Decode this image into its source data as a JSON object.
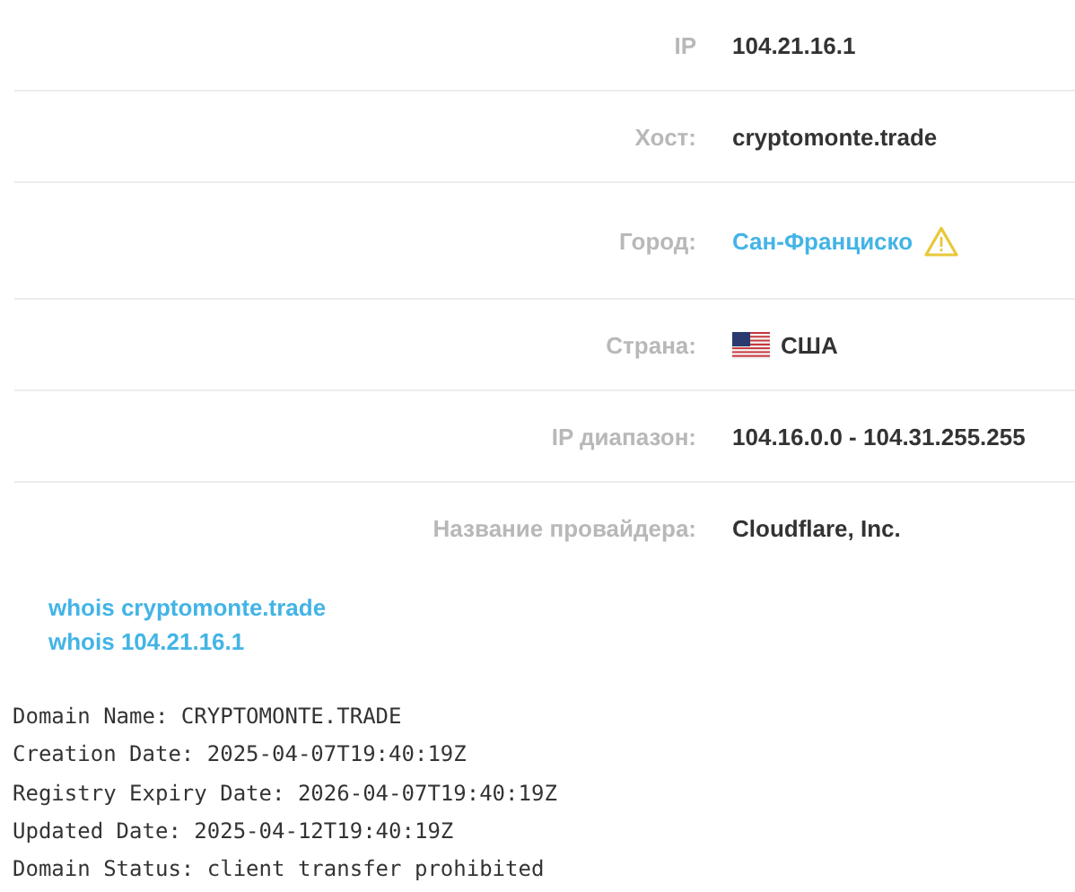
{
  "info_rows": [
    {
      "label": "IP",
      "value": "104.21.16.1",
      "kind": "text"
    },
    {
      "label": "Хост:",
      "value": "cryptomonte.trade",
      "kind": "text"
    },
    {
      "label": "Город:",
      "value": "Сан-Франциско",
      "kind": "warning-link"
    },
    {
      "label": "Страна:",
      "value": "США",
      "kind": "flag"
    },
    {
      "label": "IP диапазон:",
      "value": "104.16.0.0 - 104.31.255.255",
      "kind": "text"
    },
    {
      "label": "Название провайдера:",
      "value": "Cloudflare, Inc.",
      "kind": "text"
    }
  ],
  "whois_links": [
    "whois cryptomonte.trade",
    "whois 104.21.16.1"
  ],
  "whois_lines": [
    "Domain Name: CRYPTOMONTE.TRADE",
    "Creation Date: 2025-04-07T19:40:19Z",
    "Registry Expiry Date: 2026-04-07T19:40:19Z",
    "Updated Date: 2025-04-12T19:40:19Z",
    "Domain Status: client transfer prohibited"
  ]
}
